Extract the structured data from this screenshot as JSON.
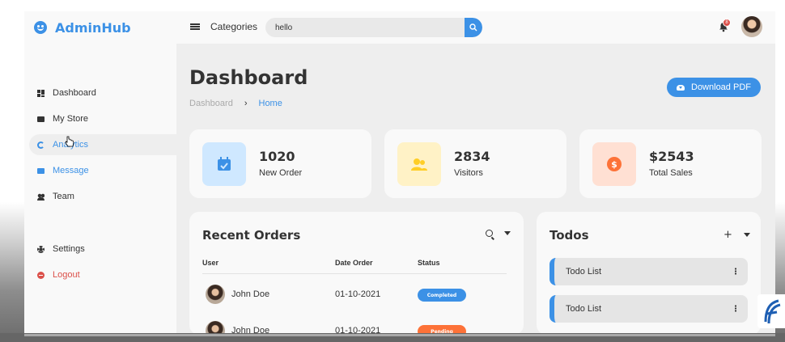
{
  "brand": {
    "name": "AdminHub",
    "icon": "smile-icon",
    "color": "#3c91e6"
  },
  "topbar": {
    "menu_icon": "menu-icon",
    "categories_label": "Categories",
    "search": {
      "value": "hello",
      "placeholder": ""
    },
    "notification_count": "8"
  },
  "sidebar": {
    "items": [
      {
        "label": "Dashboard",
        "icon": "dashboard-icon"
      },
      {
        "label": "My Store",
        "icon": "store-icon"
      },
      {
        "label": "Analytics",
        "icon": "analytics-icon",
        "active": true
      },
      {
        "label": "Message",
        "icon": "message-icon"
      },
      {
        "label": "Team",
        "icon": "team-icon"
      }
    ],
    "bottom": [
      {
        "label": "Settings",
        "icon": "settings-icon"
      },
      {
        "label": "Logout",
        "icon": "logout-icon"
      }
    ]
  },
  "main": {
    "title": "Dashboard",
    "breadcrumb": [
      "Dashboard",
      "Home"
    ],
    "breadcrumb_sep": "›",
    "download_label": "Download PDF",
    "stats": [
      {
        "value": "1020",
        "label": "New Order",
        "icon": "calendar-check-icon",
        "icon_bg": "#cfe8ff",
        "icon_color": "#3c91e6"
      },
      {
        "value": "2834",
        "label": "Visitors",
        "icon": "group-icon",
        "icon_bg": "#fff2c6",
        "icon_color": "#ffce26"
      },
      {
        "value": "$2543",
        "label": "Total Sales",
        "icon": "dollar-circle-icon",
        "icon_bg": "#ffe0d3",
        "icon_color": "#fd7238"
      }
    ],
    "orders": {
      "title": "Recent Orders",
      "columns": [
        "User",
        "Date Order",
        "Status"
      ],
      "rows": [
        {
          "user": "John Doe",
          "date": "01-10-2021",
          "status": "Completed",
          "status_color": "#3c91e6"
        },
        {
          "user": "John Doe",
          "date": "01-10-2021",
          "status": "Pending",
          "status_color": "#fd7238"
        }
      ]
    },
    "todos": {
      "title": "Todos",
      "items": [
        "Todo List",
        "Todo List"
      ]
    }
  }
}
